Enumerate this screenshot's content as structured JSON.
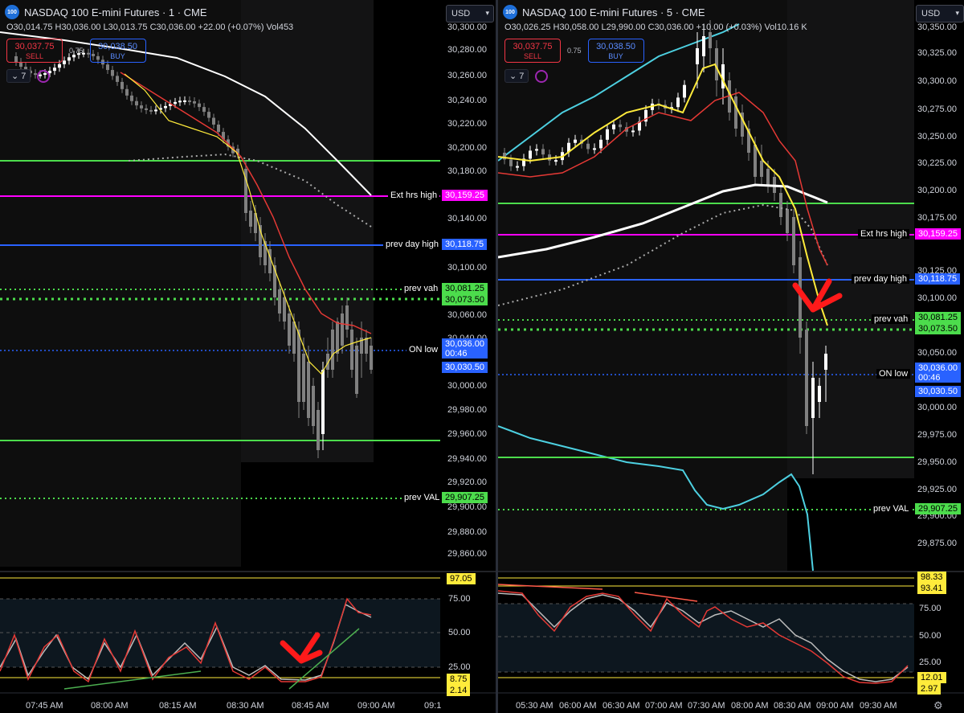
{
  "left": {
    "symbol_badge": "100",
    "title": "NASDAQ 100 E-mini Futures · 1 · CME",
    "ohlc": "O30,014.75  H30,036.00  L30,013.75  C30,036.00  +22.00 (+0.07%)  Vol453",
    "sell_price": "30,037.75",
    "sell_label": "SELL",
    "spread": "0.75",
    "buy_price": "30,038.50",
    "buy_label": "BUY",
    "indicators_count": "7",
    "currency": "USD",
    "y_ticks": [
      "30,300.00",
      "30,280.00",
      "30,260.00",
      "30,240.00",
      "30,220.00",
      "30,200.00",
      "30,180.00",
      "30,140.00",
      "30,100.00",
      "30,060.00",
      "30,040.00",
      "30,000.00",
      "29,980.00",
      "29,960.00",
      "29,940.00",
      "29,920.00",
      "29,900.00",
      "29,880.00",
      "29,860.00"
    ],
    "levels": {
      "ext_hrs_high_label": "Ext hrs high",
      "ext_hrs_high_price": "30,159.25",
      "prev_day_high_label": "prev day high",
      "prev_day_high_price": "30,118.75",
      "prev_vah_label": "prev vah",
      "prev_vah_price": "30,081.25",
      "level_2": "30,073.50",
      "on_low_label": "ON low",
      "last_price": "30,036.00",
      "countdown": "00:46",
      "on_low_price": "30,030.50",
      "prev_val_label": "prev VAL",
      "prev_val_price": "29,907.25"
    },
    "osc_ticks": [
      "97.05",
      "75.00",
      "50.00",
      "25.00",
      "8.75",
      "2.14"
    ],
    "x_ticks": [
      "07:45 AM",
      "08:00 AM",
      "08:15 AM",
      "08:30 AM",
      "08:45 AM",
      "09:00 AM",
      "09:1"
    ]
  },
  "right": {
    "symbol_badge": "100",
    "title": "NASDAQ 100 E-mini Futures · 5 · CME",
    "ohlc": "O30,026.25  H30,058.00  L29,990.00  C30,036.00  +10.00 (+0.03%)  Vol10.16 K",
    "sell_price": "30,037.75",
    "sell_label": "SELL",
    "spread": "0.75",
    "buy_price": "30,038.50",
    "buy_label": "BUY",
    "indicators_count": "7",
    "currency": "USD",
    "y_ticks": [
      "30,350.00",
      "30,325.00",
      "30,300.00",
      "30,275.00",
      "30,250.00",
      "30,225.00",
      "30,200.00",
      "30,175.00",
      "30,125.00",
      "30,100.00",
      "30,050.00",
      "30,000.00",
      "29,975.00",
      "29,950.00",
      "29,925.00",
      "29,900.00",
      "29,875.00"
    ],
    "levels": {
      "ext_hrs_high_label": "Ext hrs high",
      "ext_hrs_high_price": "30,159.25",
      "prev_day_high_label": "prev day high",
      "prev_day_high_price": "30,118.75",
      "prev_vah_label": "prev vah",
      "prev_vah_price": "30,081.25",
      "level_2": "30,073.50",
      "on_low_label": "ON low",
      "last_price": "30,036.00",
      "countdown": "00:46",
      "on_low_price": "30,030.50",
      "prev_val_label": "prev VAL",
      "prev_val_price": "29,907.25"
    },
    "osc_ticks": [
      "98.33",
      "93.41",
      "75.00",
      "50.00",
      "25.00",
      "12.01",
      "2.97"
    ],
    "x_ticks": [
      "05:30 AM",
      "06:00 AM",
      "06:30 AM",
      "07:00 AM",
      "07:30 AM",
      "08:00 AM",
      "08:30 AM",
      "09:00 AM",
      "09:30 AM"
    ]
  },
  "colors": {
    "green_level": "#4cdc4c",
    "magenta_level": "#ff00ff",
    "blue_level": "#2962ff",
    "ema_red": "#e53935",
    "ema_yellow": "#ffeb3b",
    "sma_white": "#ffffff",
    "cyan_band": "#4dd0e1",
    "arrow_red": "#ff1a1a"
  }
}
